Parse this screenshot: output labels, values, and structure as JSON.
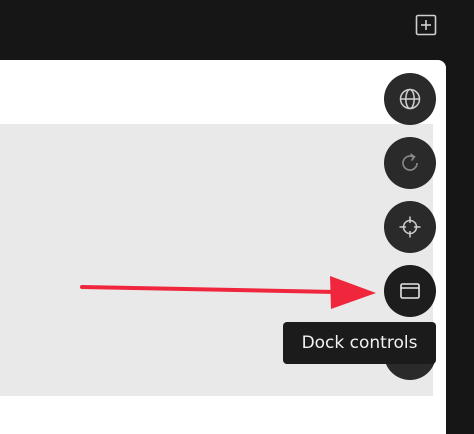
{
  "toolbar": {
    "new_tab_icon": "square-plus-icon"
  },
  "controls": {
    "buttons": [
      {
        "icon": "globe-icon"
      },
      {
        "icon": "refresh-icon"
      },
      {
        "icon": "crosshair-icon"
      },
      {
        "icon": "window-icon"
      },
      {
        "icon": "hidden-button"
      }
    ]
  },
  "tooltip": {
    "text": "Dock controls"
  },
  "colors": {
    "background": "#161616",
    "panel": "#ffffff",
    "content": "#e9e9e9",
    "button": "#2a2a2a",
    "icon": "#cfcfcf",
    "arrow": "#f0263c"
  }
}
